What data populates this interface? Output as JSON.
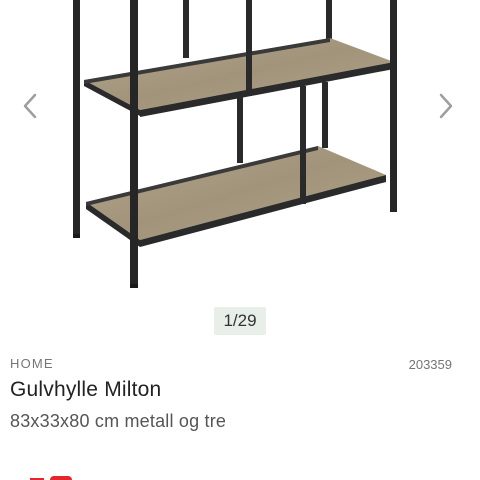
{
  "gallery": {
    "counter": "1/29",
    "prev_icon": "chevron-left-icon",
    "next_icon": "chevron-right-icon",
    "image_icon": "bookshelf-image"
  },
  "product": {
    "category": "HOME",
    "sku": "203359",
    "title": "Gulvhylle Milton",
    "subtitle": "83x33x80 cm metall og tre"
  },
  "colors": {
    "accent": "#e3262e",
    "frame": "#2a2a2a",
    "wood": "#a99c84",
    "counter_bg": "#e8efe8",
    "arrow": "#9e9e9e"
  }
}
